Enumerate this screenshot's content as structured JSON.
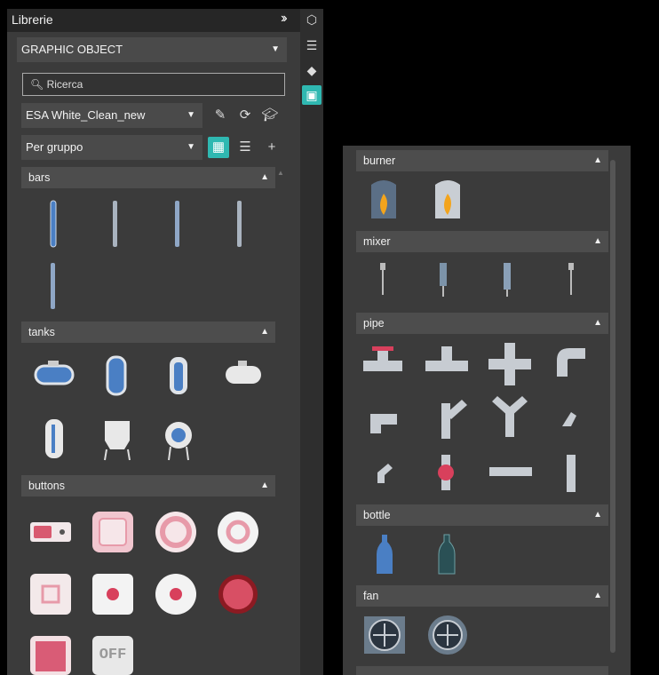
{
  "panel": {
    "title": "Librerie",
    "category": "GRAPHIC OBJECT",
    "search_placeholder": "Ricerca",
    "library": "ESA White_Clean_new",
    "grouping": "Per gruppo"
  },
  "sections": {
    "bars": "bars",
    "tanks": "tanks",
    "buttons": "buttons",
    "burner": "burner",
    "mixer": "mixer",
    "pipe": "pipe",
    "bottle": "bottle",
    "fan": "fan"
  },
  "buttons_section": {
    "off_label": "OFF"
  },
  "colors": {
    "accent": "#2fb8b1",
    "panel": "#3b3b3b",
    "header": "#4d4d4d",
    "blue_obj": "#4a7fc4"
  }
}
